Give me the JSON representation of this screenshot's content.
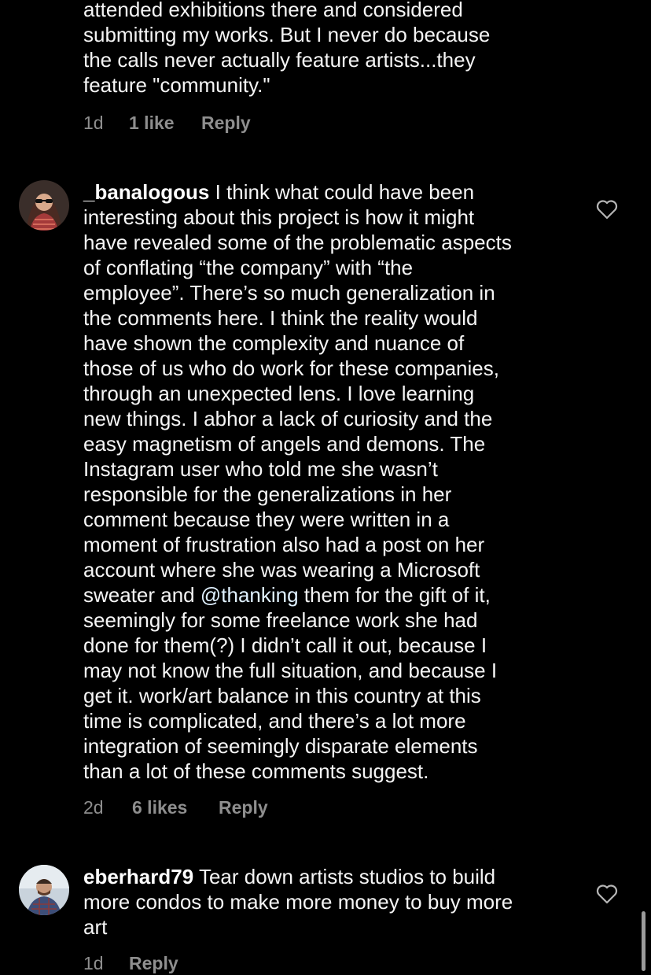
{
  "comments": [
    {
      "text": "attended exhibitions there and considered\nsubmitting my works. But I never do because\nthe calls never actually feature artists...they\nfeature \"community.\"",
      "time": "1d",
      "likes": "1 like",
      "reply": "Reply"
    },
    {
      "username": "_banalogous",
      "text_before": " I think what could have been\ninteresting about this project is how it might\nhave revealed some of the problematic aspects\nof conflating “the company” with “the\nemployee”. There’s so much generalization in\nthe comments here. I think the reality would\nhave shown the complexity and nuance of\nthose of us who do work for these companies,\nthrough an unexpected lens. I love learning\nnew things. I abhor a lack of curiosity and the\neasy magnetism of angels and demons. The\nInstagram user who told me she wasn’t\nresponsible for the generalizations in her\ncomment because they were written in a\nmoment of frustration also had a post on her\naccount where she was wearing a Microsoft\nsweater and ",
      "mention": "@thanking",
      "text_after": " them for the gift of it,\nseemingly for some freelance work she had\ndone for them(?) I didn’t call it out, because I\nmay not know the full situation, and because I\nget it. work/art balance in this country at this\ntime is complicated, and there’s a lot more\nintegration of seemingly disparate elements\nthan a lot of these comments suggest.",
      "time": "2d",
      "likes": "6 likes",
      "reply": "Reply"
    },
    {
      "username": "eberhard79",
      "text": " Tear down artists studios to build\nmore condos to make more money to buy more\nart",
      "time": "1d",
      "reply": "Reply"
    }
  ],
  "colors": {
    "background": "#000000",
    "text": "#f5f5f5",
    "meta": "#8e8e8e",
    "mention": "#e0f1ff"
  },
  "icons": {
    "like": "heart-outline-icon"
  }
}
